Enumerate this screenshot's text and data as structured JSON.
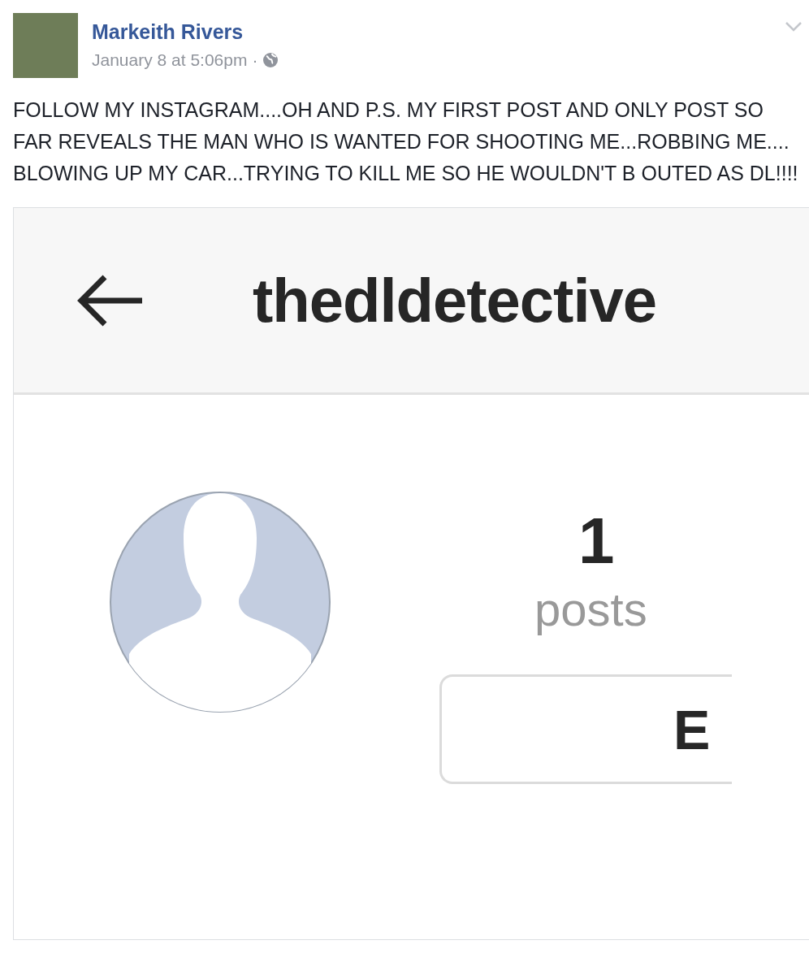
{
  "post": {
    "author": "Markeith Rivers",
    "timestamp": "January 8 at 5:06pm",
    "separator": "·",
    "text": "FOLLOW MY INSTAGRAM....OH AND P.S. MY FIRST POST AND ONLY POST SO FAR REVEALS THE MAN WHO IS WANTED FOR SHOOTING ME...ROBBING ME.... BLOWING UP MY CAR...TRYING TO KILL ME SO HE WOULDN'T B OUTED AS DL!!!!"
  },
  "embedded_screenshot": {
    "username": "thedldetective",
    "posts_count": "1",
    "posts_label": "posts",
    "button_label": "E"
  }
}
